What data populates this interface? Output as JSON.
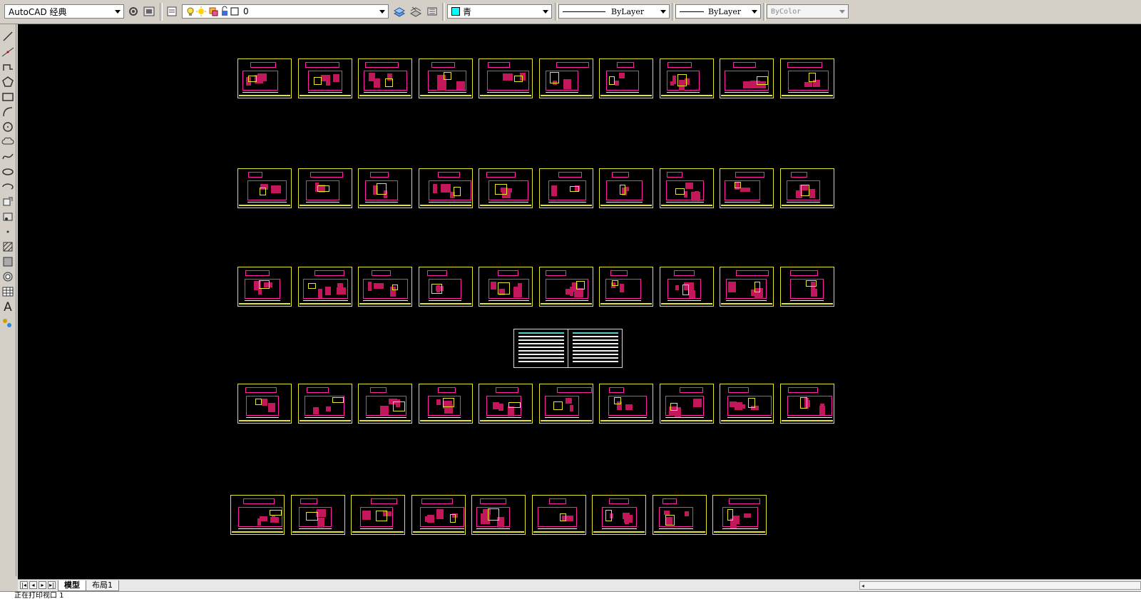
{
  "toolbar": {
    "workspace": "AutoCAD 经典",
    "layer_value": "0",
    "color_value": "青",
    "color_swatch": "#00ffff",
    "linetype_value": "ByLayer",
    "lineweight_value": "ByLayer",
    "plotstyle_value": "ByColor"
  },
  "tabs": {
    "model": "模型",
    "layout1": "布局1"
  },
  "command_line": "正在打印视口 1",
  "colors": {
    "sheet_border": "#e5e52b",
    "detail_magenta": "#ff22aa",
    "detail_red": "#c2185b",
    "canvas": "#000000"
  }
}
